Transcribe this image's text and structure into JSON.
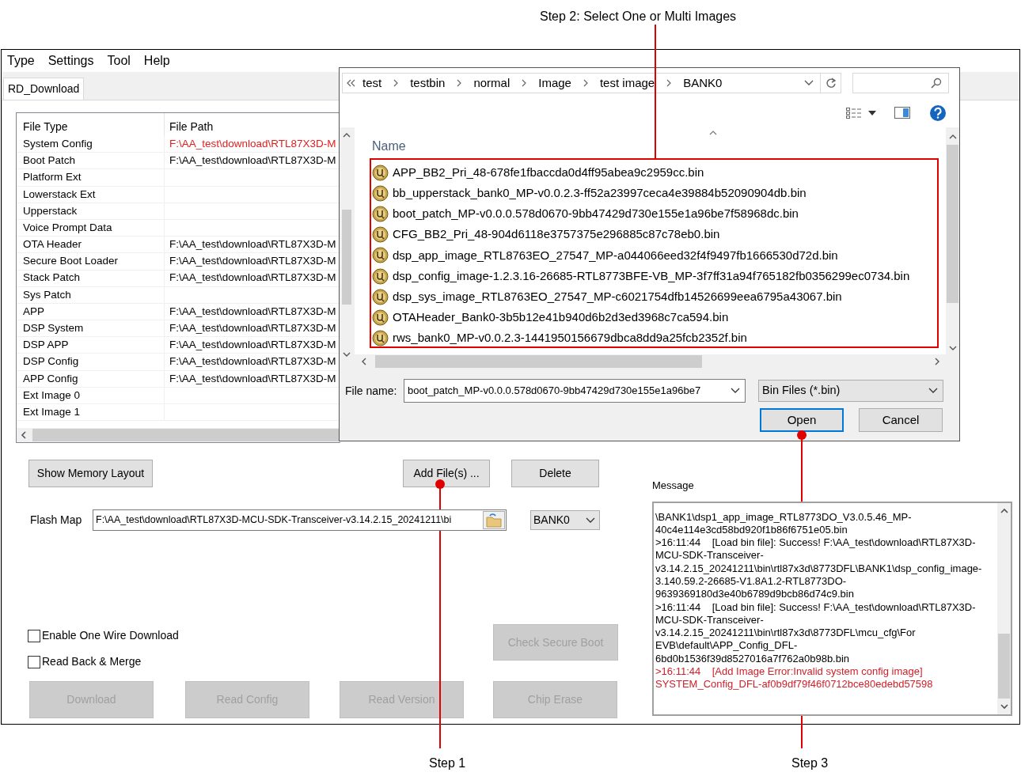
{
  "callouts": {
    "step2": "Step 2: Select One or Multi Images",
    "step1": "Step 1",
    "step3": "Step 3"
  },
  "menu": [
    "Type",
    "Settings",
    "Tool",
    "Help"
  ],
  "tabs": [
    {
      "label": "RD_Download",
      "selected": true
    }
  ],
  "file_table": {
    "columns": [
      "File Type",
      "File Path"
    ],
    "rows": [
      {
        "file_type": "System Config",
        "file_path": "F:\\AA_test\\download\\RTL87X3D-M",
        "error": true
      },
      {
        "file_type": "Boot Patch",
        "file_path": "F:\\AA_test\\download\\RTL87X3D-M",
        "error": false
      },
      {
        "file_type": "Platform Ext",
        "error": false
      },
      {
        "file_type": "Lowerstack Ext",
        "error": false
      },
      {
        "file_type": "Upperstack",
        "error": false
      },
      {
        "file_type": "Voice Prompt Data",
        "error": false
      },
      {
        "file_type": "OTA Header",
        "file_path": "F:\\AA_test\\download\\RTL87X3D-M",
        "error": false
      },
      {
        "file_type": "Secure Boot Loader",
        "file_path": "F:\\AA_test\\download\\RTL87X3D-M",
        "error": false
      },
      {
        "file_type": "Stack Patch",
        "file_path": "F:\\AA_test\\download\\RTL87X3D-M",
        "error": false
      },
      {
        "file_type": "Sys Patch",
        "error": false
      },
      {
        "file_type": "APP",
        "file_path": "F:\\AA_test\\download\\RTL87X3D-M",
        "error": false
      },
      {
        "file_type": "DSP System",
        "file_path": "F:\\AA_test\\download\\RTL87X3D-M",
        "error": false
      },
      {
        "file_type": "DSP APP",
        "file_path": "F:\\AA_test\\download\\RTL87X3D-M",
        "error": false
      },
      {
        "file_type": "DSP Config",
        "file_path": "F:\\AA_test\\download\\RTL87X3D-M",
        "error": false
      },
      {
        "file_type": "APP Config",
        "file_path": "F:\\AA_test\\download\\RTL87X3D-M",
        "error": false
      },
      {
        "file_type": "Ext Image 0",
        "error": false
      },
      {
        "file_type": "Ext Image 1",
        "error": false
      }
    ]
  },
  "top_buttons": [
    {
      "label": "Show Memory Layout",
      "disabled": false
    },
    {
      "label": "Add File(s) ...",
      "disabled": false
    },
    {
      "label": "Delete",
      "disabled": false
    }
  ],
  "flash_map": {
    "label": "Flash Map",
    "value": "F:\\AA_test\\download\\RTL87X3D-MCU-SDK-Transceiver-v3.14.2.15_20241211\\bi",
    "bank": "BANK0"
  },
  "options": [
    {
      "label": "Enable One Wire Download",
      "checked": false
    },
    {
      "label": "Read Back & Merge",
      "checked": false
    }
  ],
  "check_secure_boot": {
    "label": "Check Secure Boot",
    "disabled": true
  },
  "bottom_buttons": [
    {
      "label": "Download",
      "disabled": true
    },
    {
      "label": "Read Config",
      "disabled": true
    },
    {
      "label": "Read Version",
      "disabled": true
    },
    {
      "label": "Chip Erase",
      "disabled": true
    }
  ],
  "message": {
    "label": "Message",
    "log": [
      {
        "kind": "info",
        "text": "\\BANK1\\dsp1_app_image_RTL8773DO_V3.0.5.46_MP-40c4e114e3cd58bd920f1b86f6751e05.bin"
      },
      {
        "kind": "info",
        "text": ">16:11:44    [Load bin file]: Success! F:\\AA_test\\download\\RTL87X3D-MCU-SDK-Transceiver-v3.14.2.15_20241211\\bin\\rtl87x3d\\8773DFL\\BANK1\\dsp_config_image-3.140.59.2-26685-V1.8A1.2-RTL8773DO-9639369180d3e40b6789d9bcb86d74c9.bin"
      },
      {
        "kind": "info",
        "text": ">16:11:44    [Load bin file]: Success! F:\\AA_test\\download\\RTL87X3D-MCU-SDK-Transceiver-v3.14.2.15_20241211\\bin\\rtl87x3d\\8773DFL\\mcu_cfg\\For EVB\\default\\APP_Config_DFL-6bd0b1536f39d8527016a7f762a0b98b.bin"
      },
      {
        "kind": "error",
        "text": ">16:11:44    [Add Image Error:Invalid system config image] SYSTEM_Config_DFL-af0b9df79f46f0712bce80edebd57598"
      }
    ]
  },
  "dialog": {
    "breadcrumbs": [
      "test",
      "testbin",
      "normal",
      "Image",
      "test image",
      "BANK0"
    ],
    "list_header": "Name",
    "files": [
      "APP_BB2_Pri_48-678fe1fbaccda0d4ff95abea9c2959cc.bin",
      "bb_upperstack_bank0_MP-v0.0.2.3-ff52a23997ceca4e39884b52090904db.bin",
      "boot_patch_MP-v0.0.0.578d0670-9bb47429d730e155e1a96be7f58968dc.bin",
      "CFG_BB2_Pri_48-904d6118e3757375e296885c87c78eb0.bin",
      "dsp_app_image_RTL8763EO_27547_MP-a044066eed32f4f9497fb1666530d72d.bin",
      "dsp_config_image-1.2.3.16-26685-RTL8773BFE-VB_MP-3f7ff31a94f765182fb0356299ec0734.bin",
      "dsp_sys_image_RTL8763EO_27547_MP-c6021754dfb14526699eea6795a43067.bin",
      "OTAHeader_Bank0-3b5b12e41b940d6b2d3ed3968c7ca594.bin",
      "rws_bank0_MP-v0.0.2.3-1441950156679dbca8dd9a25fcb2352f.bin"
    ],
    "file_name_label": "File name:",
    "file_name": "boot_patch_MP-v0.0.0.578d0670-9bb47429d730e155e1a96be7",
    "filter": "Bin Files (*.bin)",
    "buttons": [
      {
        "label": "Open",
        "focused": true
      },
      {
        "label": "Cancel",
        "focused": false
      }
    ]
  }
}
